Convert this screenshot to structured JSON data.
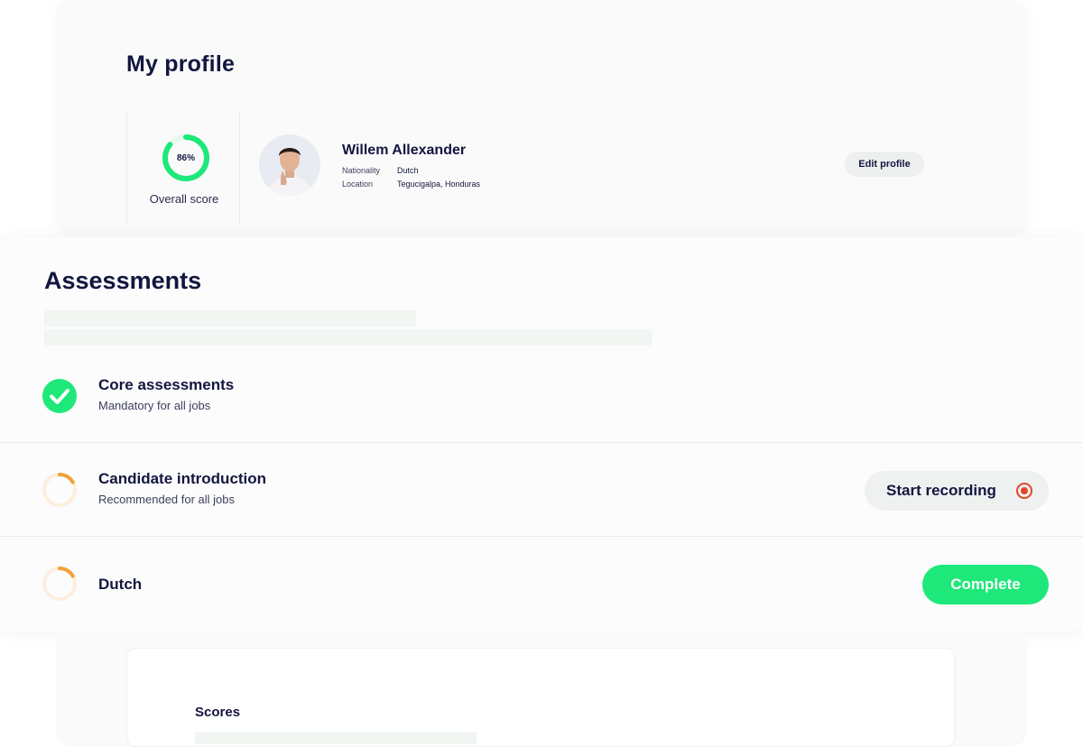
{
  "profile": {
    "title": "My profile",
    "overall_score": {
      "percent_label": "86%",
      "value": 0.86,
      "label": "Overall score"
    },
    "name": "Willem Allexander",
    "nationality_label": "Nationality",
    "nationality_value": "Dutch",
    "location_label": "Location",
    "location_value": "Tegucigalpa, Honduras",
    "edit_label": "Edit profile"
  },
  "assessments": {
    "title": "Assessments",
    "items": [
      {
        "title": "Core assessments",
        "subtitle": "Mandatory for all jobs",
        "status": "complete",
        "icon": "check-circle-icon"
      },
      {
        "title": "Candidate introduction",
        "subtitle": "Recommended for all jobs",
        "status": "in-progress",
        "action_label": "Start recording",
        "icon": "progress-ring-icon"
      },
      {
        "title": "Dutch",
        "subtitle": "",
        "status": "in-progress",
        "action_label": "Complete",
        "icon": "progress-ring-icon"
      }
    ]
  },
  "scores": {
    "title": "Scores"
  },
  "colors": {
    "accent_green": "#1ee87a",
    "progress_orange": "#f0a23a",
    "record_red": "#e2452d",
    "navy_text": "#13163f"
  }
}
